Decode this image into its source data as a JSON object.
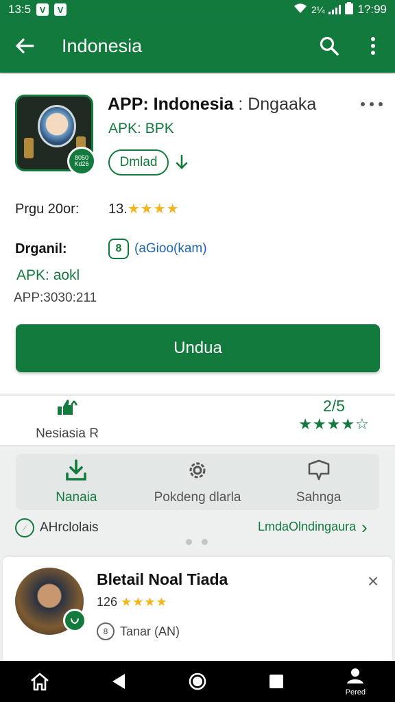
{
  "status_bar": {
    "left_time": "13:5",
    "app_icon_1": "V",
    "app_icon_2": "V",
    "battery_text": "2¼",
    "time": "1?:99"
  },
  "app_bar": {
    "title": "Indonesia",
    "back_icon": "arrow-back-icon",
    "search_icon": "search-icon",
    "more_icon": "more-vert-icon"
  },
  "app_details": {
    "name_bold": "APP: Indonesia",
    "name_rest": " : Dngaaka",
    "apk_line": "APK: BPK",
    "badge_text": "8050 Kd26",
    "pill_label": "Dmlad",
    "rating_label": "Prgu 20or:",
    "rating_value": "13.",
    "rating_stars": "★★★★",
    "developer_label": "Drganil:",
    "developer_icon": "8",
    "developer_link": "(aGioo(kam)",
    "apk_ok": "APK: aokl",
    "app_version": "APP:3030:211"
  },
  "install_button": "Undua",
  "stats": {
    "left_label": "Nesiasia R",
    "right_number": "2/5",
    "right_stars": "★★★★☆"
  },
  "actions": [
    {
      "label": "Nanaia",
      "icon": "download-icon"
    },
    {
      "label": "Pokdeng dlarla",
      "icon": "gear-icon"
    },
    {
      "label": "Sahnga",
      "icon": "share-icon"
    }
  ],
  "links": {
    "left": "AHrclolais",
    "right": "LmdaOlndingaura",
    "right_chevron": "›"
  },
  "user_card": {
    "name": "Bletail Noal Tiada",
    "rating_value": "126",
    "rating_stars": "★★★★",
    "tag_icon": "8",
    "tag_label": "Tanar (AN)",
    "close": "×"
  },
  "nav_bar": {
    "profile_label": "Pered"
  },
  "colors": {
    "brand_green": "#137a3e",
    "star_yellow": "#f2b51d",
    "link_blue": "#1f64b0"
  }
}
